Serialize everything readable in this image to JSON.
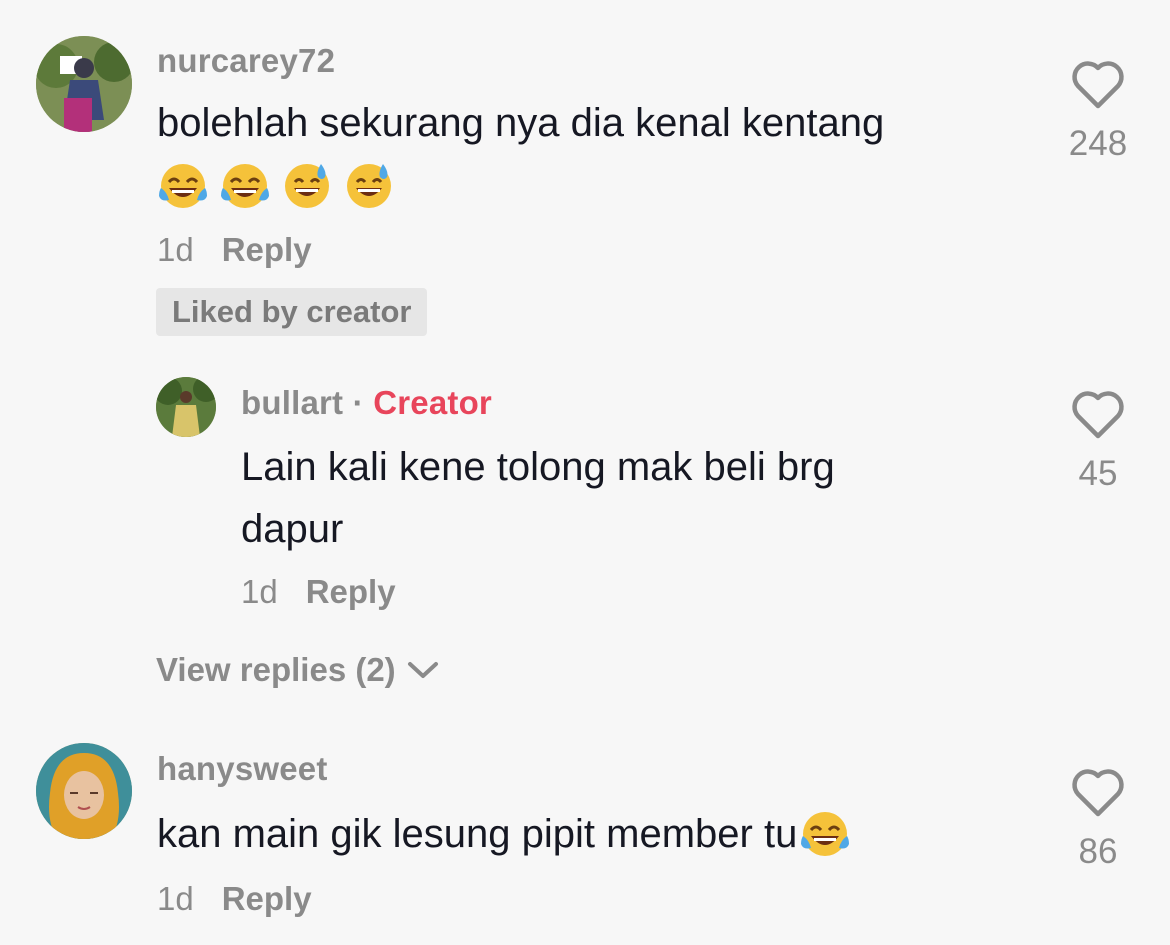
{
  "comments": [
    {
      "username": "nurcarey72",
      "text": "bolehlah sekurang nya dia kenal kentang",
      "emojis": [
        "face-with-tears-of-joy",
        "face-with-tears-of-joy",
        "grinning-face-with-sweat",
        "grinning-face-with-sweat"
      ],
      "time": "1d",
      "reply_label": "Reply",
      "liked_badge": "Liked by creator",
      "likes": "248"
    },
    {
      "username": "bullart",
      "separator": "·",
      "creator_label": "Creator",
      "text_line1": "Lain kali kene tolong mak beli brg",
      "text_line2": "dapur",
      "time": "1d",
      "reply_label": "Reply",
      "likes": "45"
    },
    {
      "username": "hanysweet",
      "text": "kan main gik lesung pipit member tu",
      "emojis": [
        "face-with-tears-of-joy"
      ],
      "time": "1d",
      "reply_label": "Reply",
      "likes": "86"
    }
  ],
  "view_replies": "View replies (2)",
  "icons": {
    "like": "heart-outline-icon",
    "expand": "chevron-down-icon"
  },
  "colors": {
    "creator": "#e8455b",
    "muted": "#8a8a8a",
    "text": "#161823",
    "background": "#f7f7f7"
  }
}
